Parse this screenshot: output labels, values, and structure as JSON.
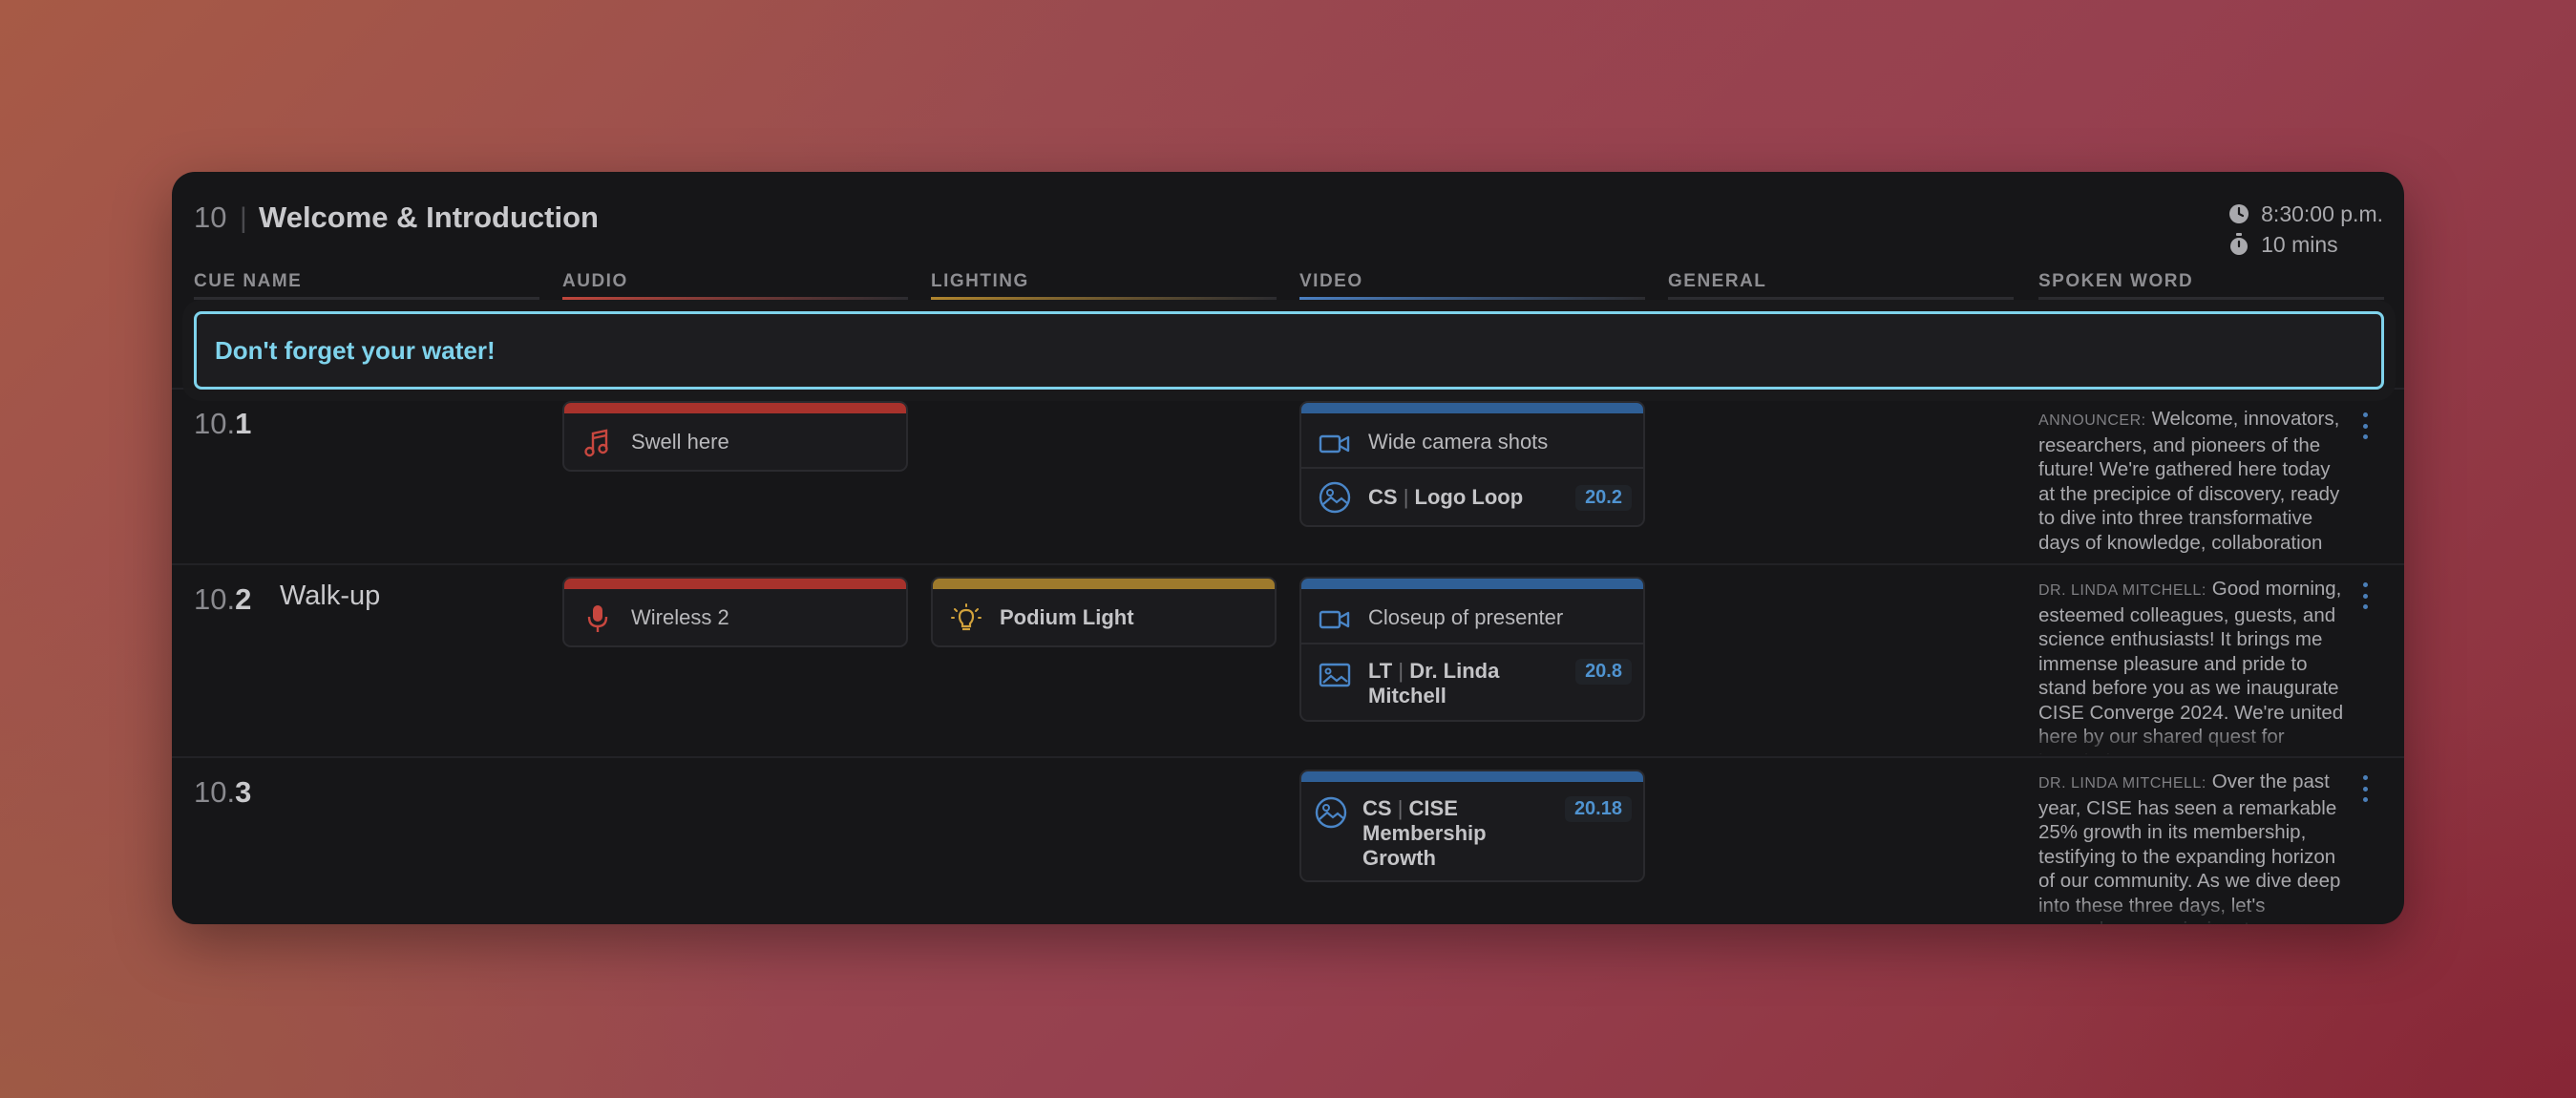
{
  "cue": {
    "number": "10",
    "separator": "|",
    "title": "Welcome & Introduction"
  },
  "meta": {
    "time": "8:30:00 p.m.",
    "duration": "10 mins"
  },
  "columns": [
    {
      "label": "CUE NAME",
      "color": "#3a3a3e"
    },
    {
      "label": "AUDIO",
      "color": "#b8433a"
    },
    {
      "label": "LIGHTING",
      "color": "#a57a2a"
    },
    {
      "label": "VIDEO",
      "color": "#3f74b5"
    },
    {
      "label": "GENERAL",
      "color": "#3a3a3e"
    },
    {
      "label": "SPOKEN WORD",
      "color": "#3a3a3e"
    }
  ],
  "notice": "Don't forget your water!",
  "colors": {
    "audio": "#a8322c",
    "lighting": "#9e7a2c",
    "video": "#2f5f96",
    "accent": "#7fd3ec",
    "badge": "#4f93d0"
  },
  "rows": [
    {
      "prefix": "10.",
      "sub": "1",
      "name": "",
      "audio": {
        "icon": "music-note-icon",
        "label": "Swell here"
      },
      "lighting": null,
      "video": {
        "icon": "video-camera-icon",
        "label": "Wide camera shots",
        "asset": {
          "icon": "image-circle-icon",
          "type": "CS",
          "sep": "|",
          "name": "Logo Loop",
          "badge": "20.2"
        }
      },
      "spoken": {
        "speaker": "ANNOUNCER:",
        "text": "Welcome, innovators, researchers, and pioneers of the future! We're gathered here today at the precipice of discovery, ready to dive into three transformative days of knowledge, collaboration"
      }
    },
    {
      "prefix": "10.",
      "sub": "2",
      "name": "Walk-up",
      "audio": {
        "icon": "microphone-icon",
        "label": "Wireless 2"
      },
      "lighting": {
        "icon": "lightbulb-icon",
        "label": "Podium Light"
      },
      "video": {
        "icon": "video-camera-icon",
        "label": "Closeup of presenter",
        "asset": {
          "icon": "image-frame-icon",
          "type": "LT",
          "sep": "|",
          "name": "Dr. Linda",
          "name2": "Mitchell",
          "badge": "20.8"
        }
      },
      "spoken": {
        "speaker": "DR. LINDA MITCHELL:",
        "text": "Good morning, esteemed colleagues, guests, and science enthusiasts! It brings me immense pleasure and pride to stand before you as we inaugurate CISE Converge 2024. We're united here by our shared quest for knowledge"
      }
    },
    {
      "prefix": "10.",
      "sub": "3",
      "name": "",
      "audio": null,
      "lighting": null,
      "video": {
        "asset": {
          "icon": "image-circle-icon",
          "type": "CS",
          "sep": "|",
          "name": "CISE",
          "name2": "Membership",
          "name3": "Growth",
          "badge": "20.18"
        }
      },
      "spoken": {
        "speaker": "DR. LINDA MITCHELL:",
        "text": "Over the past year, CISE has seen a remarkable 25% growth in its membership, testifying to the expanding horizon of our community. As we dive deep into these three days, let's remember our mission: to"
      }
    }
  ]
}
